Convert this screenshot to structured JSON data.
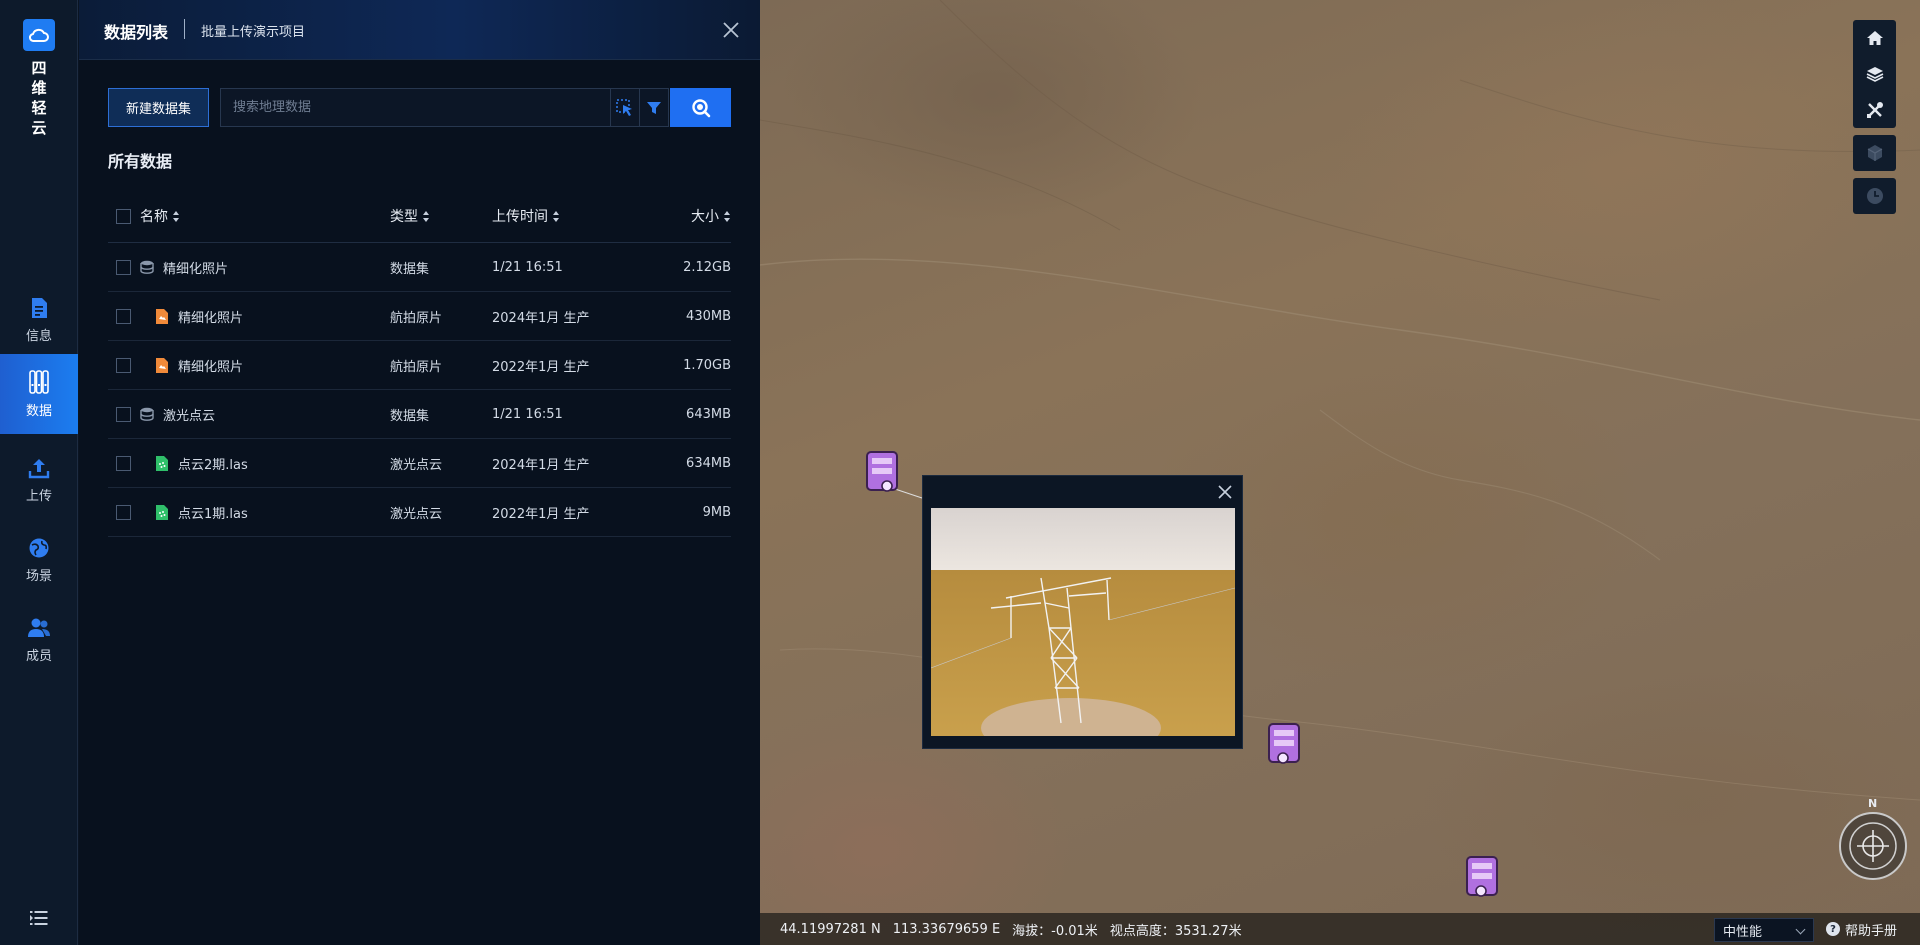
{
  "brand": {
    "chars": [
      "四",
      "维",
      "轻",
      "云"
    ],
    "accent": "#1f7cf2"
  },
  "nav": [
    {
      "label": "信息",
      "icon": "document-icon"
    },
    {
      "label": "数据",
      "icon": "database-icon",
      "active": true
    },
    {
      "label": "上传",
      "icon": "upload-icon"
    },
    {
      "label": "场景",
      "icon": "globe-icon"
    },
    {
      "label": "成员",
      "icon": "members-icon"
    }
  ],
  "panel": {
    "title": "数据列表",
    "subtitle": "批量上传演示项目",
    "new_button": "新建数据集",
    "search_placeholder": "搜索地理数据",
    "section_title": "所有数据"
  },
  "table": {
    "columns": {
      "name": "名称",
      "type": "类型",
      "time": "上传时间",
      "size": "大小"
    },
    "rows": [
      {
        "name": "精细化照片",
        "type": "数据集",
        "time": "1/21 16:51",
        "size": "2.12GB",
        "icon": "dataset-icon",
        "indent": false
      },
      {
        "name": "精细化照片",
        "type": "航拍原片",
        "time": "2024年1月 生产",
        "size": "430MB",
        "icon": "photo-file-icon",
        "indent": true
      },
      {
        "name": "精细化照片",
        "type": "航拍原片",
        "time": "2022年1月 生产",
        "size": "1.70GB",
        "icon": "photo-file-icon",
        "indent": true
      },
      {
        "name": "激光点云",
        "type": "数据集",
        "time": "1/21 16:51",
        "size": "643MB",
        "icon": "dataset-icon",
        "indent": false
      },
      {
        "name": "点云2期.las",
        "type": "激光点云",
        "time": "2024年1月 生产",
        "size": "634MB",
        "icon": "pointcloud-file-icon",
        "indent": true
      },
      {
        "name": "点云1期.las",
        "type": "激光点云",
        "time": "2022年1月 生产",
        "size": "9MB",
        "icon": "pointcloud-file-icon",
        "indent": true
      }
    ]
  },
  "compass_label": "N",
  "status": {
    "latitude": "44.11997281 N",
    "longitude": "113.33679659 E",
    "altitude": "海拔：-0.01米",
    "view_height": "视点高度：3531.27米",
    "performance": "中性能",
    "help": "帮助手册"
  },
  "colors": {
    "primary": "#1f6ff2",
    "marker": "#b070e0"
  }
}
